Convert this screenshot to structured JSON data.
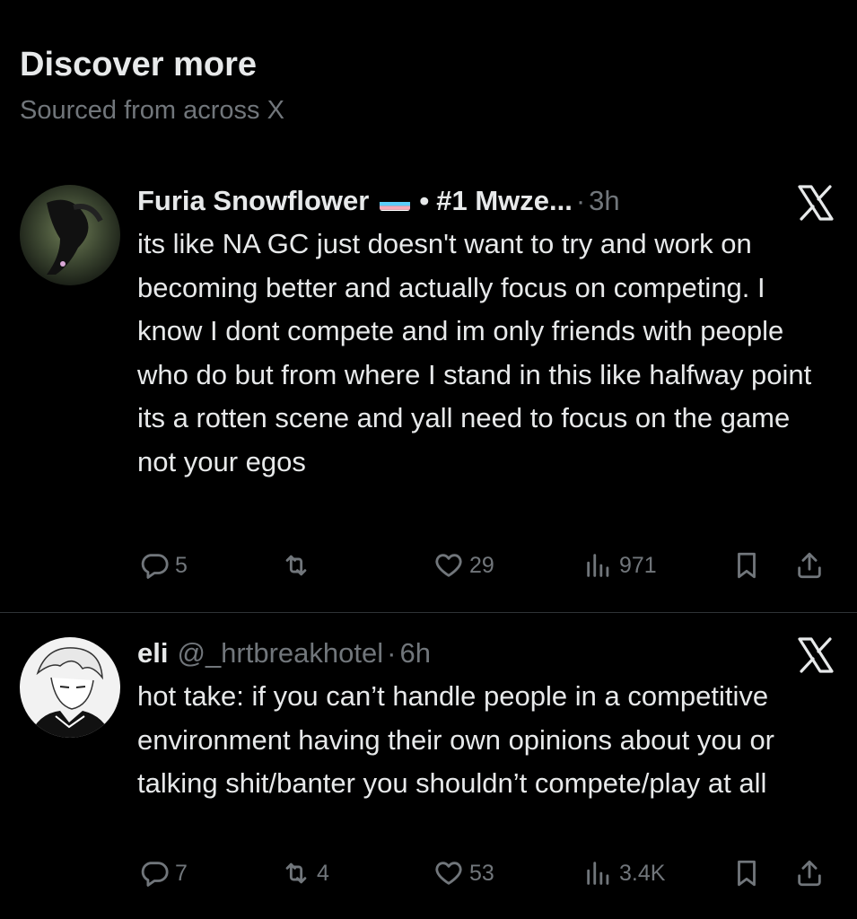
{
  "header": {
    "title": "Discover more",
    "subtitle": "Sourced from across X"
  },
  "posts": [
    {
      "name": "Furia Snowflower",
      "name_suffix": "#1 Mwze...",
      "handle": "",
      "time": "3h",
      "text": "its like NA GC just doesn't want to try and work on becoming better and actually focus on competing. I know I dont compete and im only friends with people who do but from where I stand in this like halfway point its a rotten scene and yall need to focus on the game not your egos",
      "replies": "5",
      "reposts": "",
      "likes": "29",
      "views": "971"
    },
    {
      "name": "eli",
      "handle": "@_hrtbreakhotel",
      "time": "6h",
      "text": "hot take: if you can’t handle people in a competitive environment having their own opinions about you or talking shit/banter you shouldn’t compete/play at all",
      "replies": "7",
      "reposts": "4",
      "likes": "53",
      "views": "3.4K"
    }
  ],
  "colors": {
    "background": "#000000",
    "text": "#e7e9ea",
    "muted": "#71767b",
    "divider": "#2f3336"
  }
}
